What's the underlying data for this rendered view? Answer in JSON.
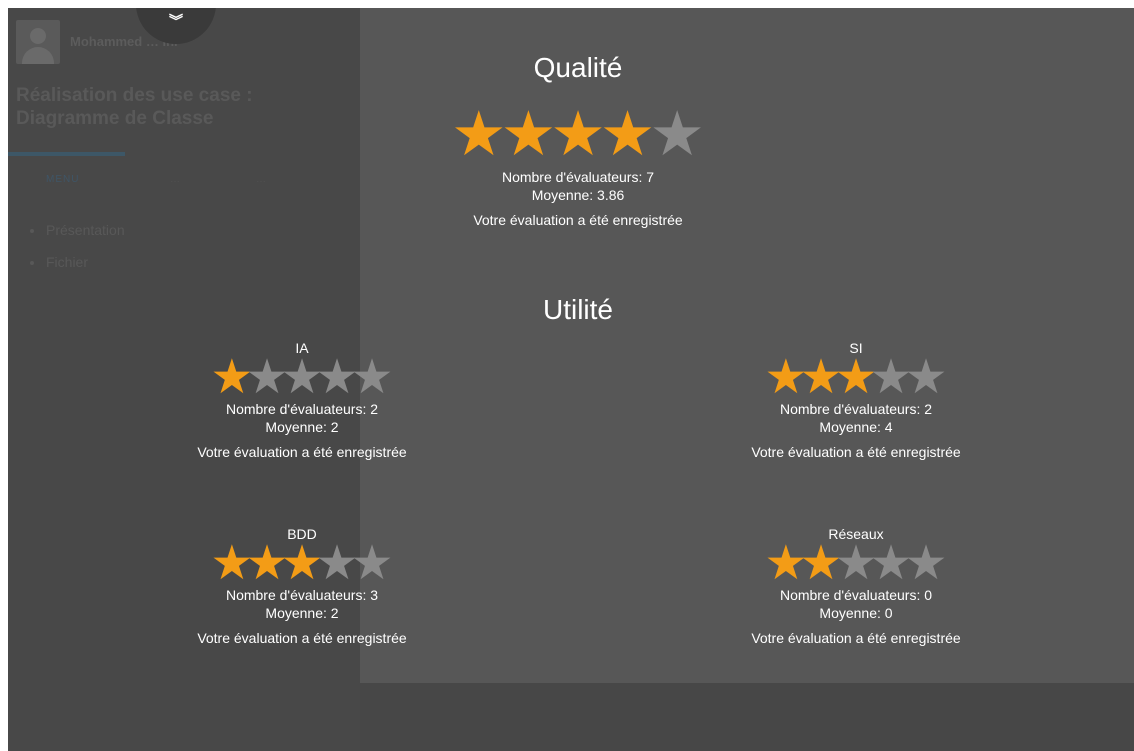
{
  "sidebar": {
    "user_name": "Mohammed … ihi",
    "course_title": "Réalisation des use case : Diagramme de Classe",
    "tabs": [
      {
        "label": "MENU"
      },
      {
        "label": "…"
      },
      {
        "label": "…"
      }
    ],
    "items": [
      {
        "label": "Présentation"
      },
      {
        "label": "Fichier"
      }
    ]
  },
  "panel": {
    "collapse_icon": "chevron-double-down-icon",
    "collapse_glyph": "»"
  },
  "qualite": {
    "title": "Qualité",
    "stars_filled": 4,
    "stars_total": 5,
    "raters_text": "Nombre d'évaluateurs: 7",
    "average_text": "Moyenne: 3.86",
    "message": "Votre évaluation a été enregistrée"
  },
  "utilite": {
    "title": "Utilité",
    "categories": [
      {
        "name": "IA",
        "stars_filled": 1,
        "stars_total": 5,
        "raters_text": "Nombre d'évaluateurs: 2",
        "average_text": "Moyenne: 2",
        "message": "Votre évaluation a été enregistrée"
      },
      {
        "name": "SI",
        "stars_filled": 3,
        "stars_total": 5,
        "raters_text": "Nombre d'évaluateurs: 2",
        "average_text": "Moyenne: 4",
        "message": "Votre évaluation a été enregistrée"
      },
      {
        "name": "BDD",
        "stars_filled": 3,
        "stars_total": 5,
        "raters_text": "Nombre d'évaluateurs: 3",
        "average_text": "Moyenne: 2",
        "message": "Votre évaluation a été enregistrée"
      },
      {
        "name": "Réseaux",
        "stars_filled": 2,
        "stars_total": 5,
        "raters_text": "Nombre d'évaluateurs: 0",
        "average_text": "Moyenne: 0",
        "message": "Votre évaluation a été enregistrée"
      }
    ]
  },
  "colors": {
    "star_on": "#f39c16",
    "star_off": "#8a8a8a",
    "panel": "#575757",
    "backdrop": "#474747"
  }
}
